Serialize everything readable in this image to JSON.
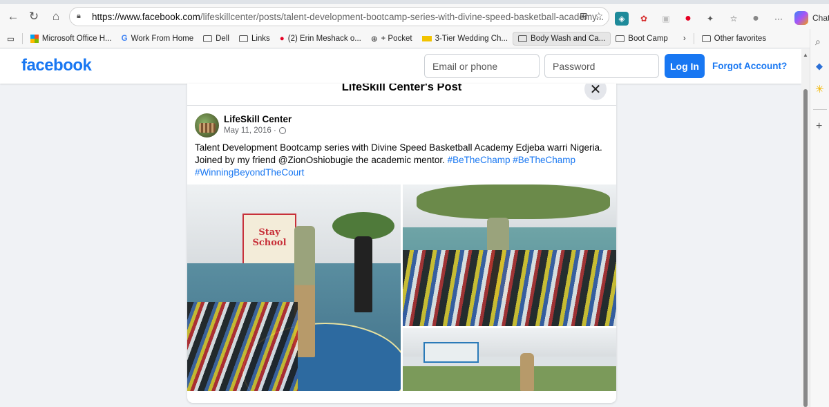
{
  "browser": {
    "url_host": "https://www.facebook.com",
    "url_path": "/lifeskillcenter/posts/talent-development-bootcamp-series-with-divine-speed-basketball-academy...",
    "chat_label": "Chat",
    "bookmarks": [
      {
        "label": "Microsoft Office H...",
        "icon": "microsoft-icon"
      },
      {
        "label": "Work From Home",
        "icon": "google-icon"
      },
      {
        "label": "Dell",
        "icon": "folder-icon"
      },
      {
        "label": "Links",
        "icon": "folder-icon"
      },
      {
        "label": "(2) Erin Meshack o...",
        "icon": "pinterest-icon"
      },
      {
        "label": "+ Pocket",
        "icon": "globe-icon"
      },
      {
        "label": "3-Tier Wedding Ch...",
        "icon": "walmart-icon"
      },
      {
        "label": "Body Wash and Ca...",
        "icon": "folder-icon"
      },
      {
        "label": "Boot Camp",
        "icon": "folder-icon"
      }
    ],
    "other_favorites": "Other favorites"
  },
  "facebook_header": {
    "logo": "facebook",
    "email_placeholder": "Email or phone",
    "password_placeholder": "Password",
    "login_label": "Log In",
    "forgot_label": "Forgot Account?"
  },
  "post": {
    "dialog_title": "LifeSkill Center's Post",
    "author": "LifeSkill Center",
    "date": "May 11, 2016 ·",
    "text": "Talent Development Bootcamp series with Divine Speed Basketball Academy Edjeba warri Nigeria. Joined by my friend @ZionOshiobugie the academic mentor.",
    "hashtags": [
      "#BeTheChamp",
      "#BeTheChamp",
      "#WinningBeyondTheCourt"
    ],
    "banner_text": "Stay School"
  },
  "colors": {
    "facebook_blue": "#1877f2",
    "page_bg": "#f0f2f5"
  }
}
